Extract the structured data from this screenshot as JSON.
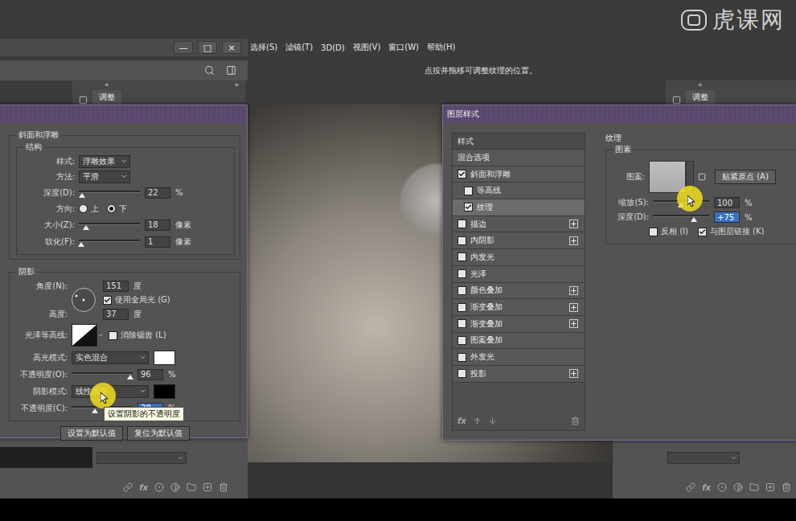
{
  "app": {
    "window_controls": [
      "—",
      "□",
      "×"
    ],
    "menu": [
      "选择(S)",
      "滤镜(T)",
      "3D(D)",
      "视图(V)",
      "窗口(W)",
      "帮助(H)"
    ],
    "status": "点按并拖移可调整纹理的位置。",
    "watermark": "虎课网"
  },
  "panels": {
    "left": {
      "collapse": "«",
      "expand": "»",
      "tab": "调整",
      "fx": "fx"
    },
    "right": {
      "collapse": "«",
      "tab": "调整",
      "fx": "fx"
    }
  },
  "bevel_dialog": {
    "section": "斜面和浮雕",
    "structure": {
      "title": "结构",
      "rows": [
        {
          "kind": "select",
          "label": "样式:",
          "value": "浮雕效果"
        },
        {
          "kind": "select",
          "label": "方法:",
          "value": "平滑"
        },
        {
          "kind": "slider",
          "label": "深度(D):",
          "level": 0.05,
          "value": "22",
          "unit": "%",
          "selected": false
        },
        {
          "kind": "radio",
          "label": "方向:",
          "options": [
            {
              "label": "上",
              "selected": false
            },
            {
              "label": "下",
              "selected": true
            }
          ]
        },
        {
          "kind": "slider",
          "label": "大小(Z):",
          "level": 0.12,
          "value": "18",
          "unit": "像素",
          "selected": false
        },
        {
          "kind": "slider",
          "label": "软化(F):",
          "level": 0.04,
          "value": "1",
          "unit": "像素",
          "selected": false
        }
      ]
    },
    "shading": {
      "title": "阴影",
      "angle": {
        "label": "角度(N):",
        "value": "151",
        "unit": "度"
      },
      "global_light": {
        "label": "使用全局光 (G)",
        "checked": true
      },
      "altitude": {
        "label": "高度:",
        "value": "37",
        "unit": "度"
      },
      "gloss_contour": {
        "label": "光泽等高线:"
      },
      "anti_alias": {
        "label": "消除锯齿 (L)",
        "checked": false
      },
      "rows": [
        {
          "kind": "mode",
          "label": "高光模式:",
          "value": "实色混合",
          "color": "#ffffff"
        },
        {
          "kind": "slider",
          "label": "不透明度(O):",
          "level": 0.96,
          "value": "96",
          "unit": "%",
          "selected": false
        },
        {
          "kind": "mode",
          "label": "阴影模式:",
          "value": "线性加深",
          "color": "#000000"
        },
        {
          "kind": "slider",
          "label": "不透明度(C):",
          "level": 0.38,
          "value": "38",
          "unit": "%",
          "selected": true
        }
      ]
    },
    "buttons": [
      "设置为默认值",
      "复位为默认值"
    ]
  },
  "layer_style_dialog": {
    "title": "图层样式",
    "list_header": "样式",
    "items": [
      {
        "label": "混合选项",
        "kind": "header",
        "selected": false,
        "addable": false
      },
      {
        "label": "斜面和浮雕",
        "kind": "check",
        "checked": true,
        "selected": false,
        "addable": false
      },
      {
        "label": "等高线",
        "kind": "sub",
        "checked": false,
        "selected": false,
        "addable": false
      },
      {
        "label": "纹理",
        "kind": "sub",
        "checked": true,
        "selected": true,
        "addable": false
      },
      {
        "label": "描边",
        "kind": "check",
        "checked": false,
        "selected": false,
        "addable": true
      },
      {
        "label": "内阴影",
        "kind": "check",
        "checked": false,
        "selected": false,
        "addable": true
      },
      {
        "label": "内发光",
        "kind": "check",
        "checked": false,
        "selected": false,
        "addable": false
      },
      {
        "label": "光泽",
        "kind": "check",
        "checked": false,
        "selected": false,
        "addable": false
      },
      {
        "label": "颜色叠加",
        "kind": "check",
        "checked": false,
        "selected": false,
        "addable": true
      },
      {
        "label": "渐变叠加",
        "kind": "check",
        "checked": false,
        "selected": false,
        "addable": true
      },
      {
        "label": "渐变叠加",
        "kind": "check",
        "checked": false,
        "selected": false,
        "addable": true
      },
      {
        "label": "图案叠加",
        "kind": "check",
        "checked": false,
        "selected": false,
        "addable": false
      },
      {
        "label": "外发光",
        "kind": "check",
        "checked": false,
        "selected": false,
        "addable": false
      },
      {
        "label": "投影",
        "kind": "check",
        "checked": false,
        "selected": false,
        "addable": true
      }
    ],
    "footer": {
      "fx": "fx"
    },
    "texture": {
      "title": "纹理",
      "group": "图素",
      "pattern_label": "图案:",
      "snap_button": "贴紧原点 (A)",
      "sliders": [
        {
          "label": "缩放(S):",
          "level": 0.5,
          "value": "100",
          "unit": "%",
          "selected": false
        },
        {
          "label": "深度(D):",
          "level": 0.73,
          "value": "+75",
          "unit": "%",
          "selected": true
        }
      ],
      "checks": [
        {
          "label": "反相 (I)",
          "checked": false
        },
        {
          "label": "与图层链接 (K)",
          "checked": true
        }
      ]
    }
  },
  "tooltip": "设置阴影的不透明度"
}
